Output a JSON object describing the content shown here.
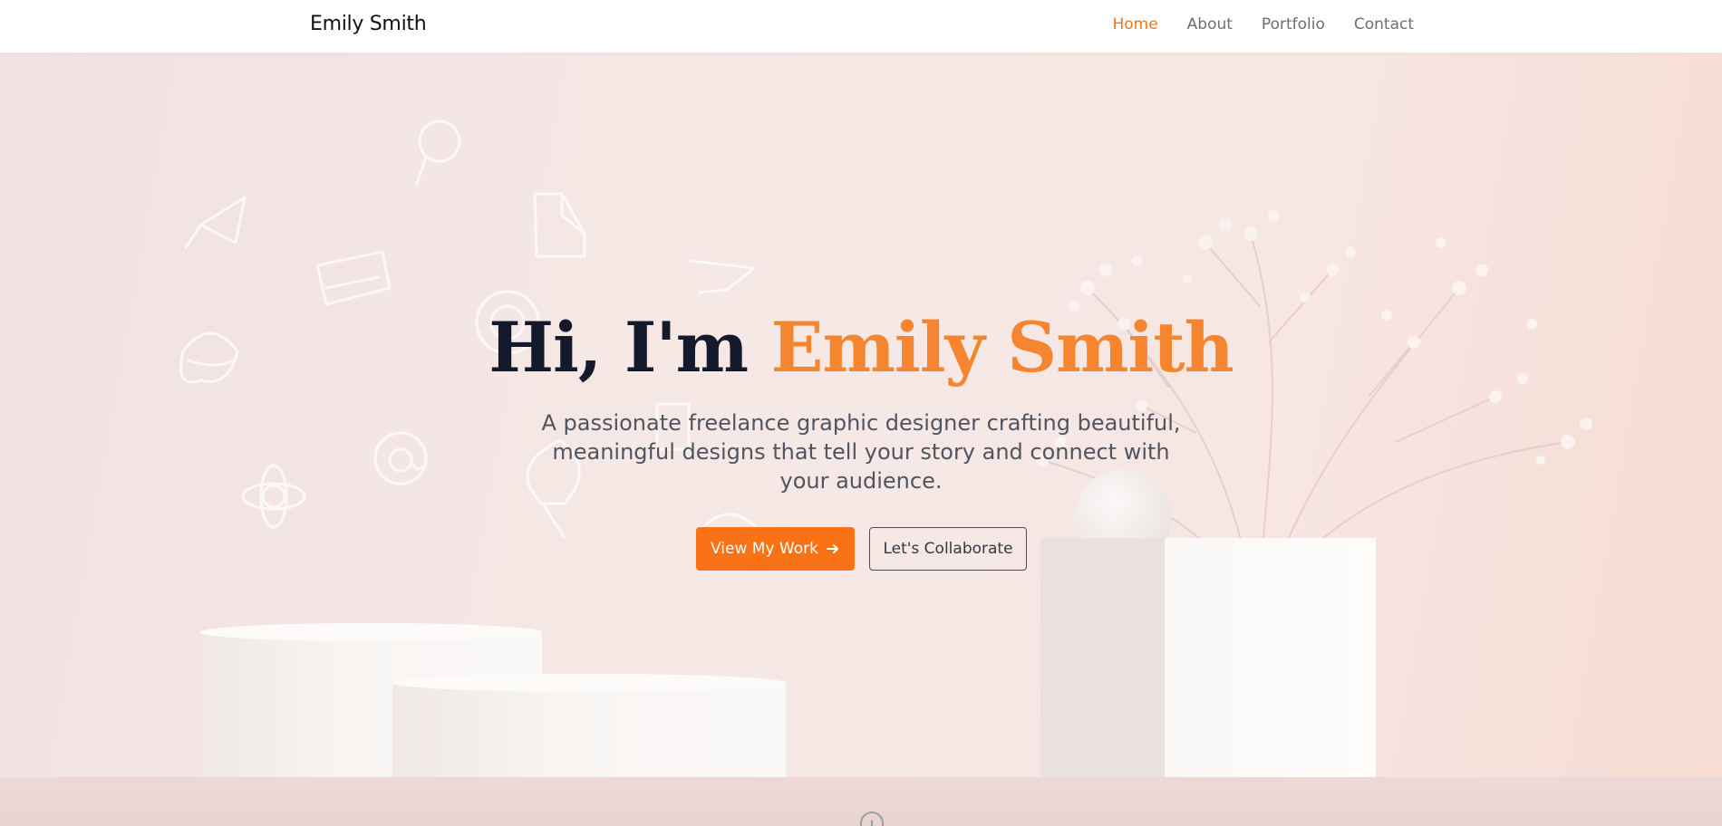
{
  "site": {
    "brand": "Emily Smith"
  },
  "nav": {
    "items": [
      {
        "label": "Home",
        "active": true
      },
      {
        "label": "About",
        "active": false
      },
      {
        "label": "Portfolio",
        "active": false
      },
      {
        "label": "Contact",
        "active": false
      }
    ]
  },
  "hero": {
    "headline_prefix": "Hi, I'm ",
    "headline_name": "Emily Smith",
    "tagline": "A passionate freelance graphic designer crafting beautiful, meaningful designs that tell your story and connect with your audience.",
    "primary_button": "View My Work",
    "secondary_button": "Let's Collaborate",
    "primary_icon": "arrow-right-icon",
    "scroll_icon": "scroll-mouse-icon"
  },
  "colors": {
    "accent": "#f97316",
    "name_accent": "#f5852f",
    "heading": "#141a2b",
    "body_text": "#4f5563",
    "nav_text": "#6b6f78"
  }
}
